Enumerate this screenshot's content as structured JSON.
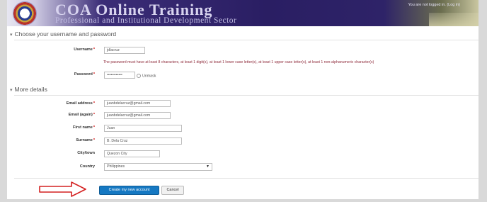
{
  "banner": {
    "title": "COA Online Training",
    "subtitle": "Professional and Institutional Development Sector",
    "login_status": "You are not logged in. (Log in)"
  },
  "sections": {
    "account": {
      "legend": "Choose your username and password"
    },
    "details": {
      "legend": "More details"
    }
  },
  "fields": {
    "username": {
      "label": "Username",
      "value": "jdlacruz"
    },
    "password_hint": "The password must have at least 8 characters, at least 1 digit(s), at least 1 lower case letter(s), at least 1 upper case letter(s), at least 1 non-alphanumeric character(s)",
    "password": {
      "label": "Password",
      "value": "••••••••••••",
      "unmask_label": "Unmask"
    },
    "email": {
      "label": "Email address",
      "value": "juanbdelacruz@gmail.com"
    },
    "email_again": {
      "label": "Email (again)",
      "value": "juanbdelacruz@gmail.com"
    },
    "firstname": {
      "label": "First name",
      "value": "Juan"
    },
    "surname": {
      "label": "Surname",
      "value": "B. Dela Cruz"
    },
    "city": {
      "label": "City/town",
      "value": "Quezon City"
    },
    "country": {
      "label": "Country",
      "value": "Philippines"
    }
  },
  "required_marker": "*",
  "buttons": {
    "submit": "Create my new account",
    "cancel": "Cancel"
  },
  "icons": {
    "collapse_toggle": "chevron-down-icon",
    "annotation": "arrow-right-icon",
    "select_caret": "caret-down-icon"
  },
  "colors": {
    "banner": "#2a1e63",
    "accent": "#1578c2",
    "hint_text": "#8e2a3a",
    "required": "#cc0000",
    "annotation_arrow": "#d42020"
  }
}
